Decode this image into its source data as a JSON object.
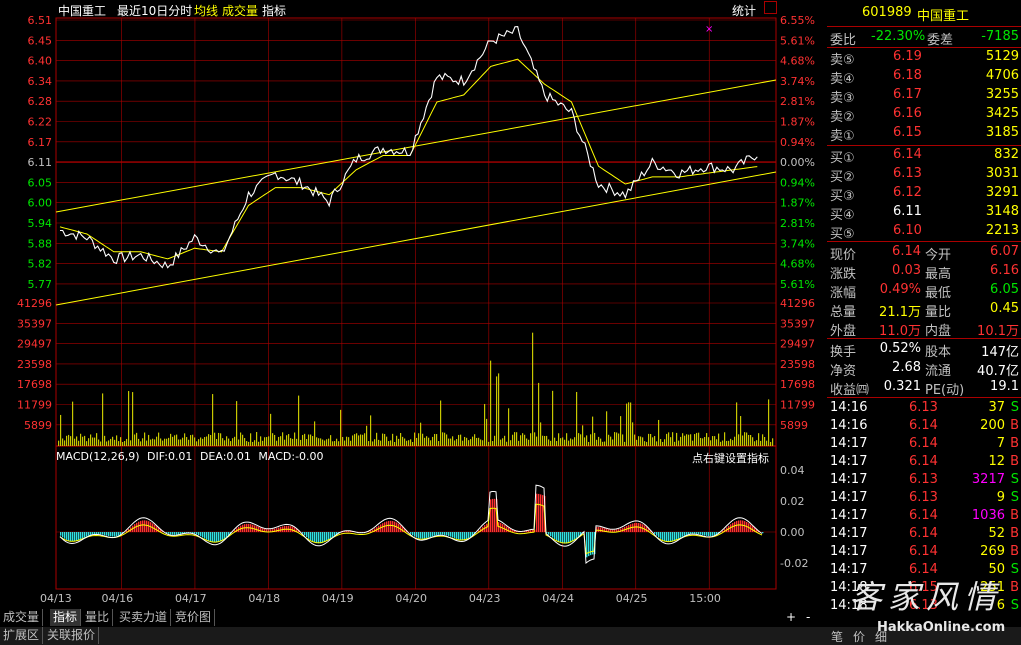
{
  "header": {
    "stock_name": "中国重工",
    "period": "最近10日分时",
    "avg_line": "均线",
    "volume": "成交量",
    "indicator": "指标",
    "stats": "统计"
  },
  "price_axis_left": [
    "6.51",
    "6.45",
    "6.40",
    "6.34",
    "6.28",
    "6.22",
    "6.17",
    "6.11",
    "6.05",
    "6.00",
    "5.94",
    "5.88",
    "5.82",
    "5.77"
  ],
  "price_axis_right": [
    "6.55%",
    "5.61%",
    "4.68%",
    "3.74%",
    "2.81%",
    "1.87%",
    "0.94%",
    "0.00%",
    "0.94%",
    "1.87%",
    "2.81%",
    "3.74%",
    "4.68%",
    "5.61%"
  ],
  "volume_axis": [
    "41296",
    "35397",
    "29497",
    "23598",
    "17698",
    "11799",
    "5899"
  ],
  "macd": {
    "label": "MACD(12,26,9)",
    "dif": "DIF:0.01",
    "dea": "DEA:0.01",
    "macd": "MACD:-0.00",
    "right_hint": "点右键设置指标",
    "axis": [
      "0.04",
      "0.02",
      "0.00",
      "-0.02"
    ]
  },
  "date_axis": [
    "04/13",
    "04/16",
    "04/17",
    "04/18",
    "04/19",
    "04/20",
    "04/23",
    "04/24",
    "04/25",
    "15:00"
  ],
  "bottom_tabs": [
    "成交量",
    "指标",
    "量比",
    "买卖力道",
    "竞价图"
  ],
  "bottom_tabs2": [
    "扩展区",
    "关联报价"
  ],
  "scroll_buttons": [
    "+",
    "-"
  ],
  "colors": {
    "up": "#ff3232",
    "down": "#00e600",
    "price_line": "#ffffff",
    "avg_line": "#ffff00",
    "volume": "#c8c800",
    "grid": "#aa0000",
    "macd_pos": "#ff3030",
    "macd_neg": "#30e0e0"
  },
  "quote": {
    "code": "601989",
    "name": "中国重工",
    "weibi_label": "委比",
    "weibi": "-22.30%",
    "weicha_label": "委差",
    "weicha": "-7185",
    "sells": [
      {
        "label": "卖⑤",
        "price": "6.19",
        "vol": "5129"
      },
      {
        "label": "卖④",
        "price": "6.18",
        "vol": "4706"
      },
      {
        "label": "卖③",
        "price": "6.17",
        "vol": "3255"
      },
      {
        "label": "卖②",
        "price": "6.16",
        "vol": "3425"
      },
      {
        "label": "卖①",
        "price": "6.15",
        "vol": "3185"
      }
    ],
    "buys": [
      {
        "label": "买①",
        "price": "6.14",
        "vol": "832"
      },
      {
        "label": "买②",
        "price": "6.13",
        "vol": "3031"
      },
      {
        "label": "买③",
        "price": "6.12",
        "vol": "3291"
      },
      {
        "label": "买④",
        "price": "6.11",
        "vol": "3148"
      },
      {
        "label": "买⑤",
        "price": "6.10",
        "vol": "2213"
      }
    ],
    "stats": [
      {
        "l1": "现价",
        "v1": "6.14",
        "l2": "今开",
        "v2": "6.07"
      },
      {
        "l1": "涨跌",
        "v1": "0.03",
        "l2": "最高",
        "v2": "6.16"
      },
      {
        "l1": "涨幅",
        "v1": "0.49%",
        "l2": "最低",
        "v2": "6.05"
      },
      {
        "l1": "总量",
        "v1": "21.1万",
        "l2": "量比",
        "v2": "0.45"
      },
      {
        "l1": "外盘",
        "v1": "11.0万",
        "l2": "内盘",
        "v2": "10.1万"
      }
    ],
    "stats2": [
      {
        "l1": "换手",
        "v1": "0.52%",
        "l2": "股本",
        "v2": "147亿"
      },
      {
        "l1": "净资",
        "v1": "2.68",
        "l2": "流通",
        "v2": "40.7亿"
      },
      {
        "l1": "收益㈣",
        "v1": "0.321",
        "l2": "PE(动)",
        "v2": "19.1"
      }
    ],
    "ticks": [
      {
        "time": "14:16",
        "price": "6.13",
        "vol": "37",
        "bs": "S"
      },
      {
        "time": "14:16",
        "price": "6.14",
        "vol": "200",
        "bs": "B"
      },
      {
        "time": "14:17",
        "price": "6.14",
        "vol": "7",
        "bs": "B"
      },
      {
        "time": "14:17",
        "price": "6.14",
        "vol": "12",
        "bs": "B"
      },
      {
        "time": "14:17",
        "price": "6.13",
        "vol": "3217",
        "bs": "S"
      },
      {
        "time": "14:17",
        "price": "6.13",
        "vol": "9",
        "bs": "S"
      },
      {
        "time": "14:17",
        "price": "6.14",
        "vol": "1036",
        "bs": "B"
      },
      {
        "time": "14:17",
        "price": "6.14",
        "vol": "52",
        "bs": "B"
      },
      {
        "time": "14:17",
        "price": "6.14",
        "vol": "269",
        "bs": "B"
      },
      {
        "time": "14:17",
        "price": "6.14",
        "vol": "50",
        "bs": "S"
      },
      {
        "time": "14:18",
        "price": "6.15",
        "vol": "251",
        "bs": "B"
      },
      {
        "time": "14:18",
        "price": "6.13",
        "vol": "6",
        "bs": "S"
      }
    ],
    "bottom_tabs": [
      "笔",
      "价",
      "细"
    ]
  },
  "watermark": {
    "text": "客家风情",
    "url": "HakkaOnline.com"
  },
  "chart_data": {
    "type": "line",
    "title": "",
    "x": [
      "04/13",
      "04/16",
      "04/17",
      "04/18",
      "04/19",
      "04/20",
      "04/23",
      "04/24",
      "04/25",
      "15:00"
    ],
    "ylim": [
      5.77,
      6.51
    ],
    "series": [
      {
        "values": [
          5.92,
          5.9,
          5.84,
          5.85,
          5.82,
          5.9,
          5.85,
          6.02,
          6.08,
          6.05,
          6.0,
          6.12,
          6.15,
          6.14,
          6.35,
          6.34,
          6.45,
          6.48,
          6.3,
          6.25,
          6.05,
          6.02,
          6.11,
          6.08,
          6.1,
          6.09,
          6.14
        ]
      },
      {
        "values": [
          5.93,
          5.91,
          5.86,
          5.86,
          5.84,
          5.87,
          5.86,
          5.99,
          6.04,
          6.04,
          6.02,
          6.09,
          6.13,
          6.13,
          6.28,
          6.3,
          6.38,
          6.4,
          6.33,
          6.28,
          6.1,
          6.05,
          6.07,
          6.07,
          6.08,
          6.09,
          6.1
        ]
      }
    ]
  }
}
